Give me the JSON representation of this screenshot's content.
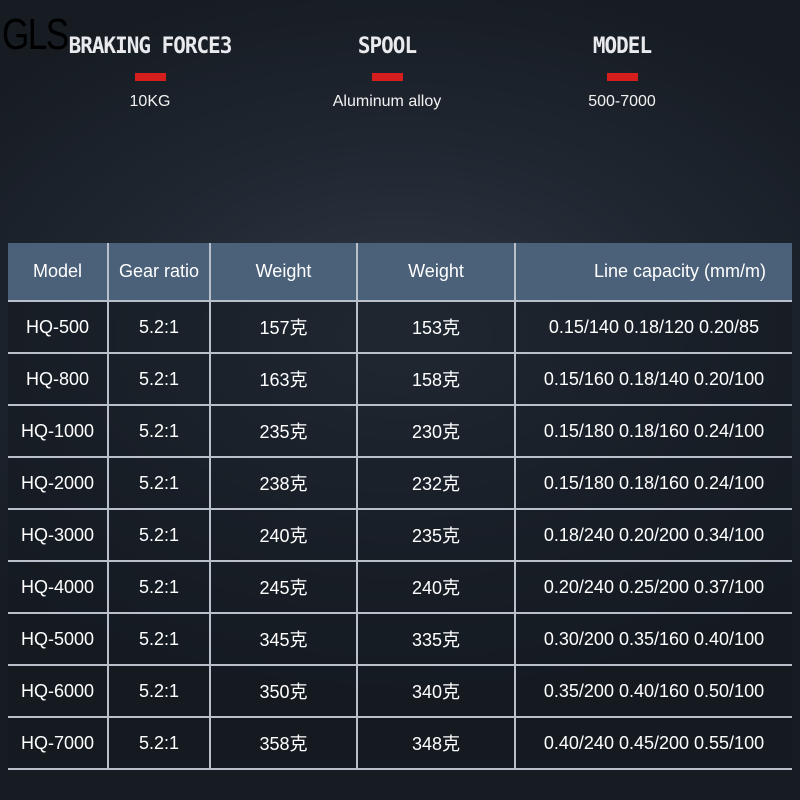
{
  "watermark": "GLS",
  "features": [
    {
      "title": "BRAKING FORCE3",
      "value": "10KG"
    },
    {
      "title": "SPOOL",
      "value": "Aluminum alloy"
    },
    {
      "title": "MODEL",
      "value": "500-7000"
    }
  ],
  "table": {
    "headers": [
      "Model",
      "Gear ratio",
      "Weight",
      "Weight",
      "Line capacity (mm/m)"
    ],
    "rows": [
      [
        "HQ-500",
        "5.2:1",
        "157克",
        "153克",
        "0.15/140 0.18/120 0.20/85"
      ],
      [
        "HQ-800",
        "5.2:1",
        "163克",
        "158克",
        "0.15/160 0.18/140 0.20/100"
      ],
      [
        "HQ-1000",
        "5.2:1",
        "235克",
        "230克",
        "0.15/180 0.18/160 0.24/100"
      ],
      [
        "HQ-2000",
        "5.2:1",
        "238克",
        "232克",
        "0.15/180 0.18/160 0.24/100"
      ],
      [
        "HQ-3000",
        "5.2:1",
        "240克",
        "235克",
        "0.18/240 0.20/200 0.34/100"
      ],
      [
        "HQ-4000",
        "5.2:1",
        "245克",
        "240克",
        "0.20/240 0.25/200 0.37/100"
      ],
      [
        "HQ-5000",
        "5.2:1",
        "345克",
        "335克",
        "0.30/200 0.35/160 0.40/100"
      ],
      [
        "HQ-6000",
        "5.2:1",
        "350克",
        "340克",
        "0.35/200 0.40/160 0.50/100"
      ],
      [
        "HQ-7000",
        "5.2:1",
        "358克",
        "348克",
        "0.40/240 0.45/200 0.55/100"
      ]
    ]
  }
}
